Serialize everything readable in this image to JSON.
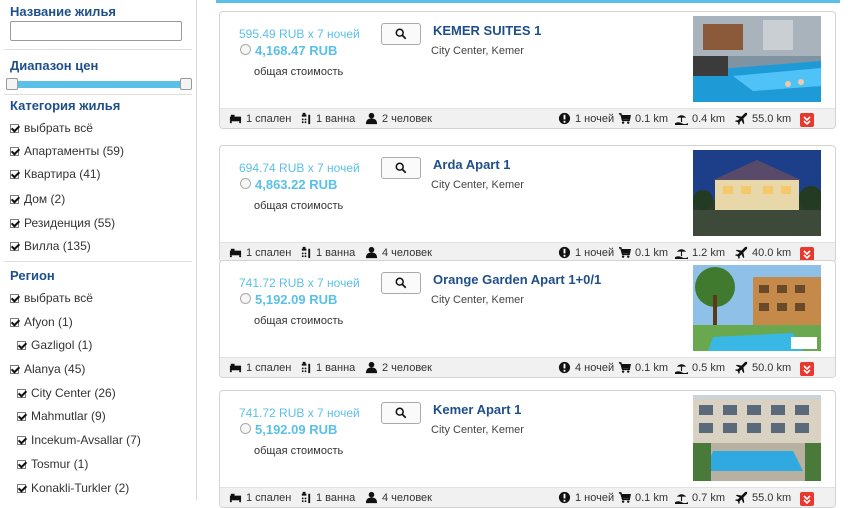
{
  "sidebar": {
    "name_title": "Название жилья",
    "name_input_value": "",
    "range_title": "Диапазон цен",
    "price_range": [
      0,
      1
    ],
    "category_title": "Категория жилья",
    "categories": [
      {
        "label": "выбрать всё",
        "checked": true
      },
      {
        "label": "Апартаменты (59)",
        "checked": true
      },
      {
        "label": "Квартира (41)",
        "checked": true
      },
      {
        "label": "Дом (2)",
        "checked": true
      },
      {
        "label": "Резиденция (55)",
        "checked": true
      },
      {
        "label": "Вилла (135)",
        "checked": true
      }
    ],
    "region_title": "Регион",
    "regions": [
      {
        "label": "выбрать всё",
        "checked": true,
        "level": 0
      },
      {
        "label": "Afyon (1)",
        "checked": true,
        "level": 0
      },
      {
        "label": "Gazligol (1)",
        "checked": true,
        "level": 1
      },
      {
        "label": "Alanya (45)",
        "checked": true,
        "level": 0
      },
      {
        "label": "City Center (26)",
        "checked": true,
        "level": 1
      },
      {
        "label": "Mahmutlar (9)",
        "checked": true,
        "level": 1
      },
      {
        "label": "Incekum-Avsallar (7)",
        "checked": true,
        "level": 1
      },
      {
        "label": "Tosmur (1)",
        "checked": true,
        "level": 1
      },
      {
        "label": "Konakli-Turkler (2)",
        "checked": true,
        "level": 1
      }
    ]
  },
  "colors": {
    "accent": "#5bc0e8",
    "title": "#1f4f8a",
    "danger": "#e8392f"
  },
  "listings": [
    {
      "per_night": "595.49 RUB x 7 ночей",
      "total": "4,168.47 RUB",
      "total_label": "общая стоимость",
      "name": "KEMER SUITES 1",
      "location": "City Center, Kemer",
      "photo": "pool-terrace",
      "features": {
        "bedrooms": "1 спален",
        "bathrooms": "1 ванна",
        "guests": "2 человек",
        "nights": "1 ночей",
        "shop": "0.1 km",
        "beach": "0.4 km",
        "airport": "55.0 km"
      }
    },
    {
      "per_night": "694.74 RUB x 7 ночей",
      "total": "4,863.22 RUB",
      "total_label": "общая стоимость",
      "name": "Arda Apart 1",
      "location": "City Center, Kemer",
      "photo": "night-building",
      "features": {
        "bedrooms": "1 спален",
        "bathrooms": "1 ванна",
        "guests": "4 человек",
        "nights": "1 ночей",
        "shop": "0.1 km",
        "beach": "1.2 km",
        "airport": "40.0 km"
      }
    },
    {
      "per_night": "741.72 RUB x 7 ночей",
      "total": "5,192.09 RUB",
      "total_label": "общая стоимость",
      "name": "Orange Garden Apart 1+0/1",
      "location": "City Center, Kemer",
      "photo": "garden-pool",
      "features": {
        "bedrooms": "1 спален",
        "bathrooms": "1 ванна",
        "guests": "2 человек",
        "nights": "4 ночей",
        "shop": "0.1 km",
        "beach": "0.5 km",
        "airport": "50.0 km"
      }
    },
    {
      "per_night": "741.72 RUB x 7 ночей",
      "total": "5,192.09 RUB",
      "total_label": "общая стоимость",
      "name": "Kemer Apart 1",
      "location": "City Center, Kemer",
      "photo": "courtyard-pool",
      "features": {
        "bedrooms": "1 спален",
        "bathrooms": "1 ванна",
        "guests": "4 человек",
        "nights": "1 ночей",
        "shop": "0.1 km",
        "beach": "0.7 km",
        "airport": "55.0 km"
      }
    }
  ]
}
